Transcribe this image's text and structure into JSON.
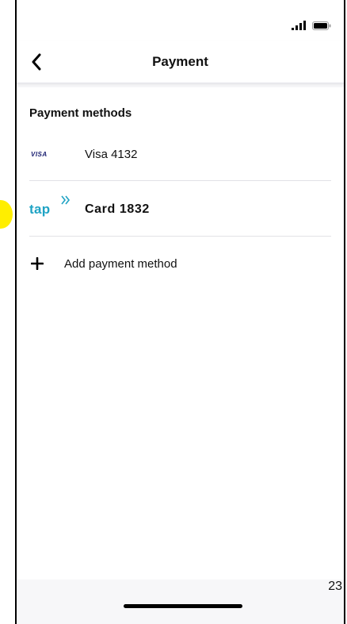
{
  "nav": {
    "title": "Payment"
  },
  "payment_methods": {
    "header": "Payment methods",
    "items": [
      {
        "brand": "VISA",
        "label": "Visa 4132"
      },
      {
        "brand": "tap",
        "label": "Card 1832"
      }
    ],
    "add_label": "Add payment method"
  },
  "footer": {
    "page_number": "23"
  },
  "colors": {
    "tap_brand": "#1fa3c4",
    "visa_brand": "#1a1f71",
    "highlight_marker": "#ffee00"
  }
}
